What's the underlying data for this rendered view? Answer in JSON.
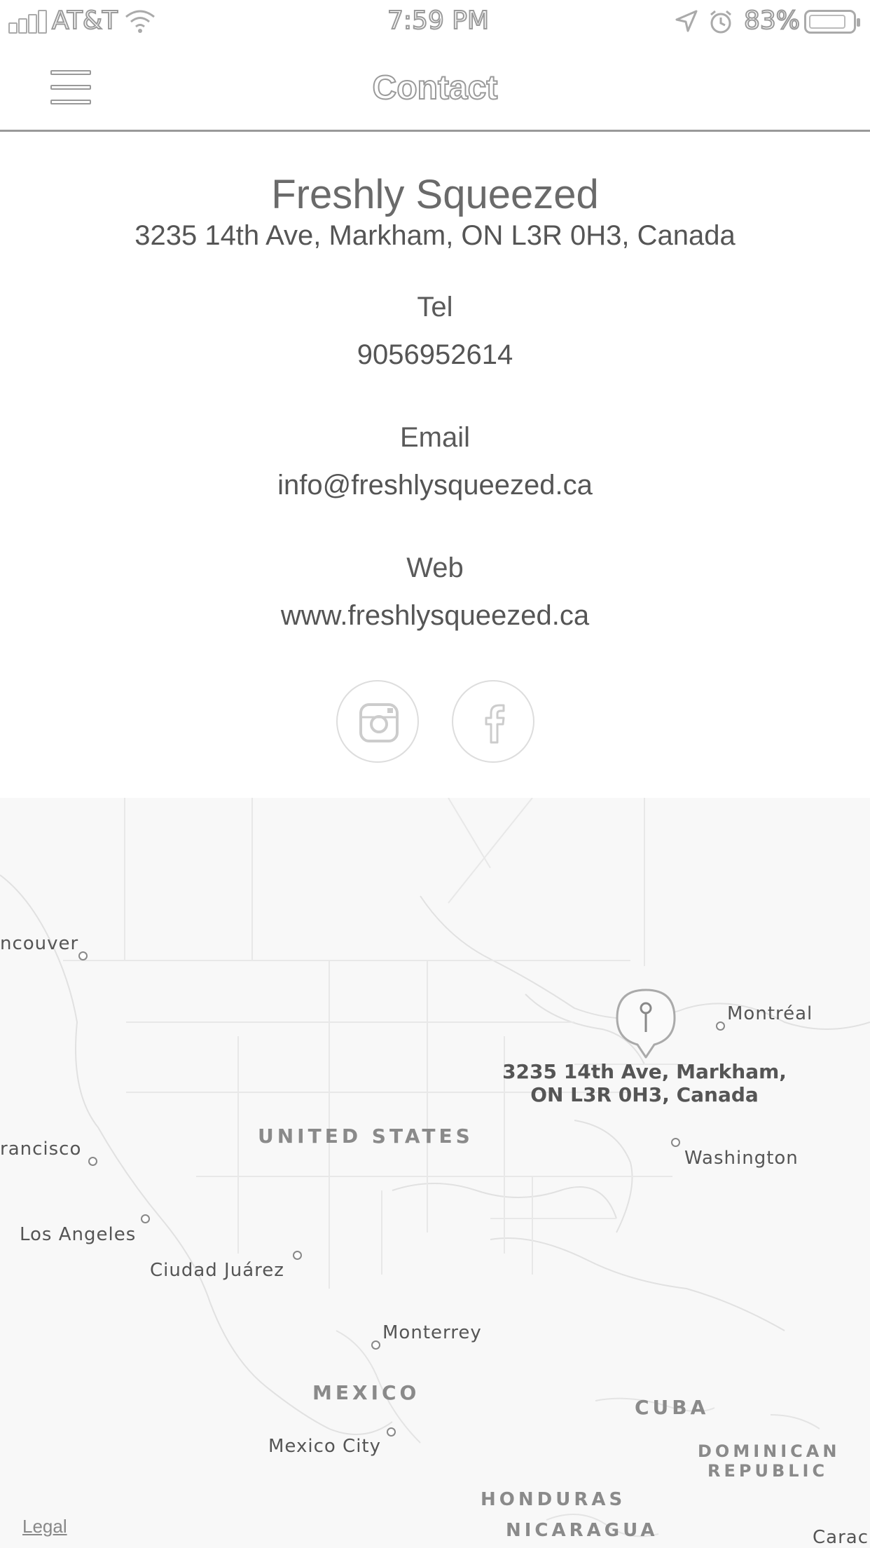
{
  "status_bar": {
    "carrier": "AT&T",
    "time": "7:59 PM",
    "battery": "83%"
  },
  "header": {
    "title": "Contact",
    "menu_icon": "hamburger-menu-icon"
  },
  "contact": {
    "name": "Freshly Squeezed",
    "address": "3235 14th Ave, Markham, ON L3R 0H3, Canada",
    "tel_label": "Tel",
    "tel": "9056952614",
    "email_label": "Email",
    "email": "info@freshlysqueezed.ca",
    "web_label": "Web",
    "web": "www.freshlysqueezed.ca"
  },
  "social": [
    {
      "icon": "instagram-icon"
    },
    {
      "icon": "facebook-icon"
    }
  ],
  "map": {
    "pin_label_line1": "3235 14th Ave, Markham,",
    "pin_label_line2": "ON L3R 0H3, Canada",
    "cities": {
      "vancouver": "ncouver",
      "montreal": "Montréal",
      "washington": "Washington",
      "san_francisco": "rancisco",
      "los_angeles": "Los Angeles",
      "ciudad_juarez": "Ciudad Juárez",
      "monterrey": "Monterrey",
      "mexico_city": "Mexico City",
      "caracas": "Carac"
    },
    "countries": {
      "us": "UNITED STATES",
      "mexico": "MEXICO",
      "cuba": "CUBA",
      "dominican_1": "DOMINICAN",
      "dominican_2": "REPUBLIC",
      "honduras": "HONDURAS",
      "nicaragua": "NICARAGUA"
    },
    "legal": "Legal"
  }
}
